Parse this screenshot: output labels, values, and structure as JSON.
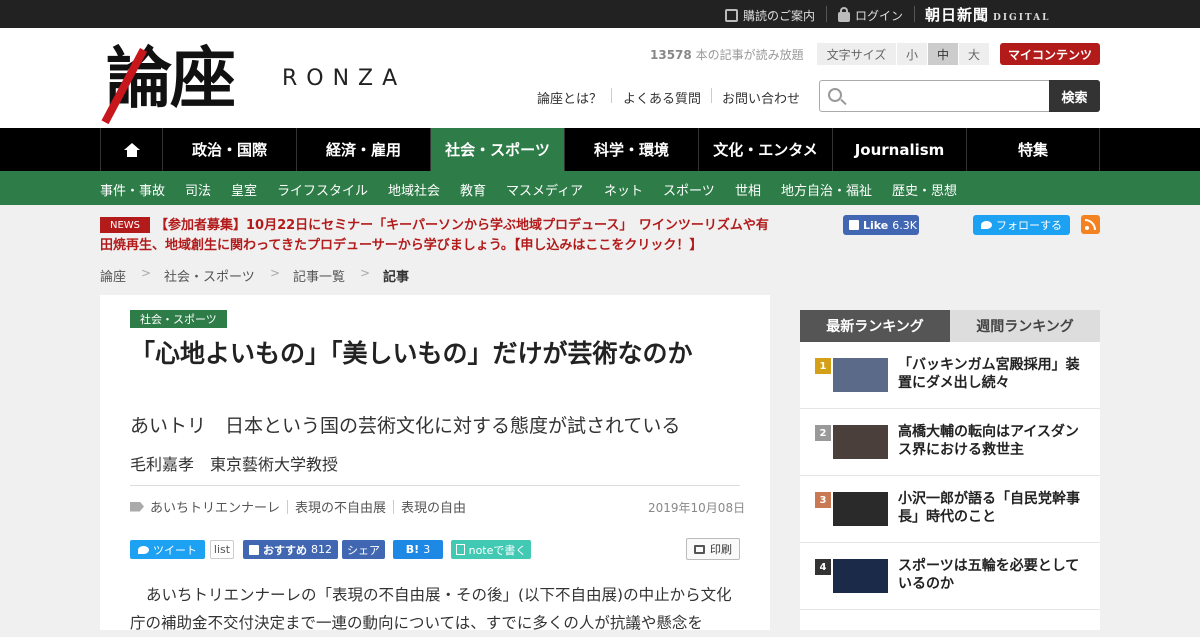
{
  "topbar": {
    "guide": "購読のご案内",
    "login": "ログイン",
    "brand": "朝日新聞",
    "brand_sub": "DIGITAL"
  },
  "header": {
    "logo_text": "論座",
    "logo_en": "RONZA",
    "count_number": "13578",
    "count_text": " 本の記事が読み放題",
    "font_size_label": "文字サイズ",
    "font_small": "小",
    "font_medium": "中",
    "font_large": "大",
    "my_content": "マイコンテンツ",
    "links": [
      "論座とは？",
      "よくある質問",
      "お問い合わせ"
    ],
    "search_placeholder": "",
    "search_button": "検索"
  },
  "nav": {
    "items": [
      "政治・国際",
      "経済・雇用",
      "社会・スポーツ",
      "科学・環境",
      "文化・エンタメ",
      "Journalism",
      "特集"
    ],
    "active": "社会・スポーツ"
  },
  "subnav": {
    "items": [
      "事件・事故",
      "司法",
      "皇室",
      "ライフスタイル",
      "地域社会",
      "教育",
      "マスメディア",
      "ネット",
      "スポーツ",
      "世相",
      "地方自治・福祉",
      "歴史・思想"
    ]
  },
  "news": {
    "badge": "NEWS",
    "text": "【参加者募集】10月22日にセミナー「キーパーソンから学ぶ地域プロデュース」　ワインツーリズムや有田焼再生、地域創生に関わってきたプロデューサーから学びましょう。【申し込みはここをクリック！】"
  },
  "social": {
    "fb_like": "Like",
    "fb_count": "6.3K",
    "twitter_follow": "フォローする"
  },
  "breadcrumb": [
    "論座",
    "社会・スポーツ",
    "記事一覧",
    "記事"
  ],
  "breadcrumb_sep": ">",
  "article": {
    "category": "社会・スポーツ",
    "title": "「心地よいもの」「美しいもの」だけが芸術なのか",
    "subtitle": "あいトリ　日本という国の芸術文化に対する態度が試されている",
    "author": "毛利嘉孝　東京藝術大学教授",
    "tags": [
      "あいちトリエンナーレ",
      "表現の不自由展",
      "表現の自由"
    ],
    "date": "2019年10月08日",
    "share": {
      "tweet": "ツイート",
      "list": "list",
      "fb_recommend": "おすすめ",
      "fb_count": "812",
      "fb_share": "シェア",
      "hatena_count": "3",
      "note": "noteで書く",
      "print": "印刷"
    },
    "body": "あいちトリエンナーレの「表現の不自由展・その後」(以下不自由展)の中止から文化庁の補助金不交付決定まで一連の動向については、すでに多くの人が抗議や懸念を"
  },
  "ranking": {
    "tab_latest": "最新ランキング",
    "tab_weekly": "週間ランキング",
    "items": [
      {
        "num": "1",
        "title": "「バッキンガム宮殿採用」装置にダメ出し続々",
        "color": "#d4a017"
      },
      {
        "num": "2",
        "title": "高橋大輔の転向はアイスダンス界における救世主",
        "color": "#999999"
      },
      {
        "num": "3",
        "title": "小沢一郎が語る「自民党幹事長」時代のこと",
        "color": "#c87852"
      },
      {
        "num": "4",
        "title": "スポーツは五輪を必要としているのか",
        "color": "#333333"
      }
    ]
  },
  "colors": {
    "nav_active": "#2e7d48",
    "accent_red": "#b31b1b"
  }
}
